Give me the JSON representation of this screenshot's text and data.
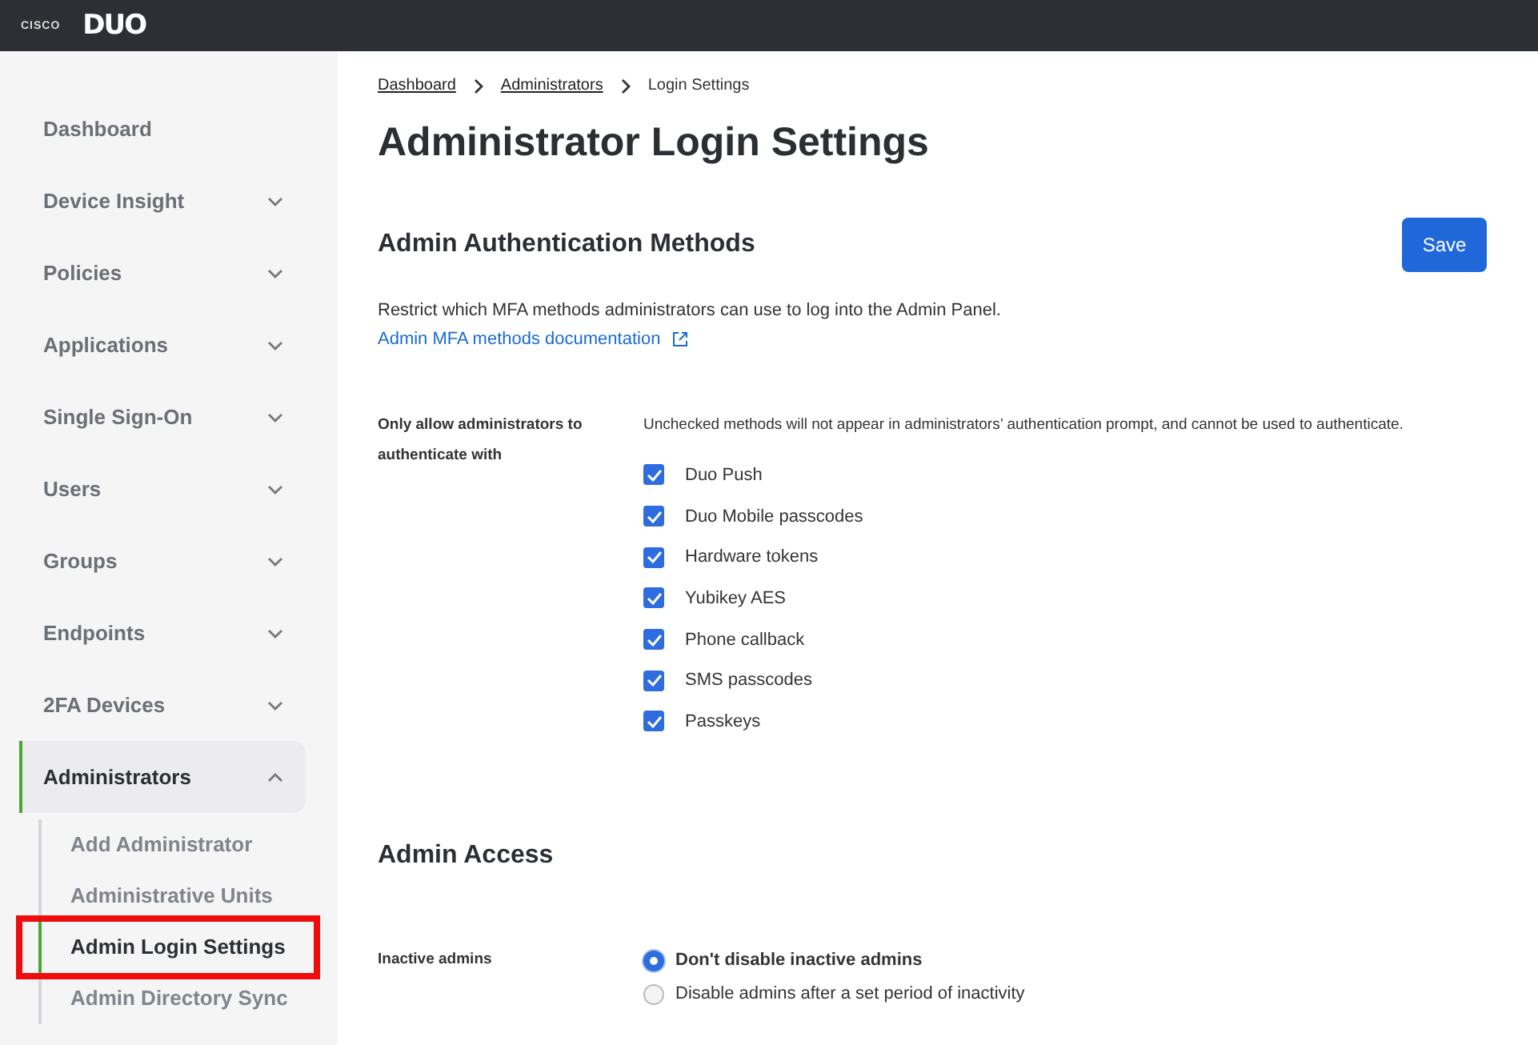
{
  "topbar": {
    "brand": "CISCO",
    "product": "DUO"
  },
  "sidebar": {
    "items": [
      {
        "label": "Dashboard",
        "selected": false
      },
      {
        "label": "Device Insight",
        "expandable": true,
        "expanded": false,
        "selected": false
      },
      {
        "label": "Policies",
        "expandable": true,
        "expanded": false,
        "selected": false
      },
      {
        "label": "Applications",
        "expandable": true,
        "expanded": false,
        "selected": false
      },
      {
        "label": "Single Sign-On",
        "expandable": true,
        "expanded": false,
        "selected": false
      },
      {
        "label": "Users",
        "expandable": true,
        "expanded": false,
        "selected": false
      },
      {
        "label": "Groups",
        "expandable": true,
        "expanded": false,
        "selected": false
      },
      {
        "label": "Endpoints",
        "expandable": true,
        "expanded": false,
        "selected": false
      },
      {
        "label": "2FA Devices",
        "expandable": true,
        "expanded": false,
        "selected": false
      },
      {
        "label": "Administrators",
        "expandable": true,
        "expanded": true,
        "selected": true,
        "children": [
          {
            "label": "Add Administrator",
            "selected": false,
            "highlighted": false
          },
          {
            "label": "Administrative Units",
            "selected": false,
            "highlighted": false
          },
          {
            "label": "Admin Login Settings",
            "selected": true,
            "highlighted": true
          },
          {
            "label": "Admin Directory Sync",
            "selected": false,
            "highlighted": false
          }
        ]
      }
    ]
  },
  "breadcrumb": [
    {
      "label": "Dashboard",
      "link": true
    },
    {
      "label": "Administrators",
      "link": true
    },
    {
      "label": "Login Settings",
      "link": false
    }
  ],
  "page_title": "Administrator Login Settings",
  "auth_section": {
    "title": "Admin Authentication Methods",
    "save_button": "Save",
    "description": "Restrict which MFA methods administrators can use to log into the Admin Panel.",
    "doc_link": "Admin MFA methods documentation",
    "field_label": "Only allow administrators to authenticate with",
    "hint": "Unchecked methods will not appear in administrators’ authentication prompt, and cannot be used to authenticate.",
    "methods": [
      {
        "label": "Duo Push",
        "checked": true
      },
      {
        "label": "Duo Mobile passcodes",
        "checked": true
      },
      {
        "label": "Hardware tokens",
        "checked": true
      },
      {
        "label": "Yubikey AES",
        "checked": true
      },
      {
        "label": "Phone callback",
        "checked": true
      },
      {
        "label": "SMS passcodes",
        "checked": true
      },
      {
        "label": "Passkeys",
        "checked": true
      }
    ]
  },
  "access_section": {
    "title": "Admin Access",
    "field_label": "Inactive admins",
    "options": [
      {
        "label": "Don't disable inactive admins",
        "selected": true
      },
      {
        "label": "Disable admins after a set period of inactivity",
        "selected": false
      }
    ]
  }
}
